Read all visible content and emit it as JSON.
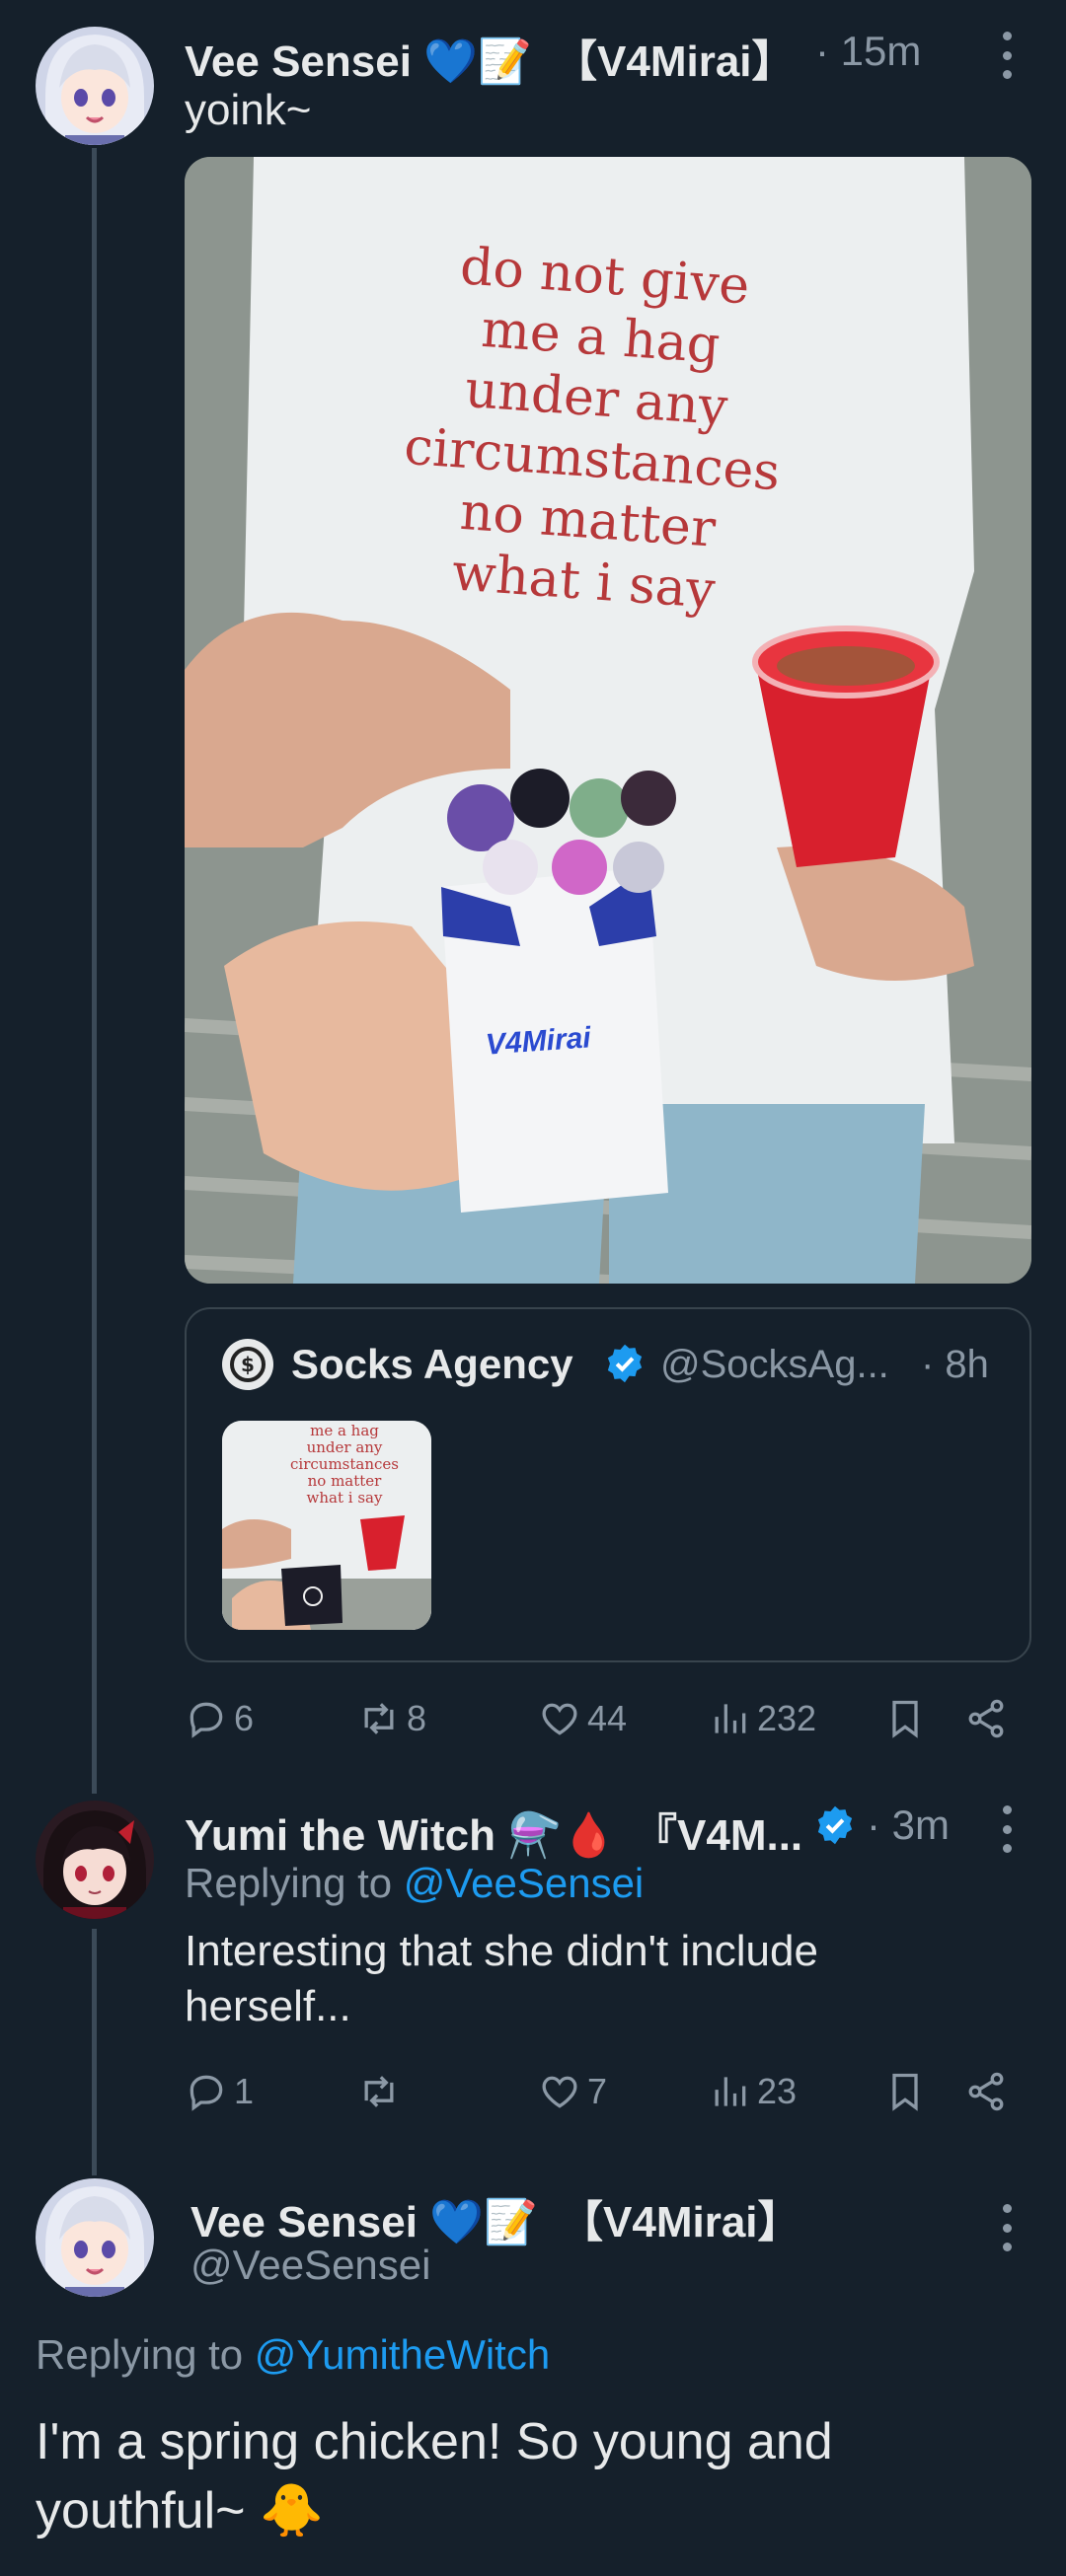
{
  "tweet1": {
    "display_name": "Vee Sensei",
    "name_emojis": "💙📝",
    "name_tag": "【V4Mirai】",
    "time": "· 15m",
    "text": "yoink~",
    "media": {
      "shirt_lines": [
        "do not give",
        "me a hag",
        "under any",
        "circumstances",
        "no matter",
        "what i say"
      ],
      "pack_logo": "V4Mirai"
    },
    "quote": {
      "display_name": "Socks Agency",
      "handle": "@SocksAg...",
      "time": "· 8h",
      "thumb_lines": [
        "me a hag",
        "under any",
        "circumstances",
        "no matter",
        "what i say"
      ]
    },
    "stats": {
      "replies": "6",
      "reposts": "8",
      "likes": "44",
      "views": "232"
    }
  },
  "tweet2": {
    "display_name": "Yumi the Witch",
    "name_emojis": "⚗️🩸",
    "name_tag": "『V4M...",
    "time": "· 3m",
    "replying_label": "Replying to",
    "replying_to": "@VeeSensei",
    "text_line1": "Interesting that she didn't include",
    "text_line2": "herself...",
    "stats": {
      "replies": "1",
      "reposts": "",
      "likes": "7",
      "views": "23"
    }
  },
  "tweet3": {
    "display_name": "Vee Sensei",
    "name_emojis": "💙📝",
    "name_tag": "【V4Mirai】",
    "handle": "@VeeSensei",
    "replying_label": "Replying to",
    "replying_to": "@YumitheWitch",
    "text_line1": "I'm a spring chicken! So young and",
    "text_line2": "youthful~",
    "text_emoji": "🐥"
  },
  "colors": {
    "background": "#15202b",
    "accent": "#1d9bf0",
    "muted": "#8b98a5",
    "text": "#e7e9ea"
  }
}
